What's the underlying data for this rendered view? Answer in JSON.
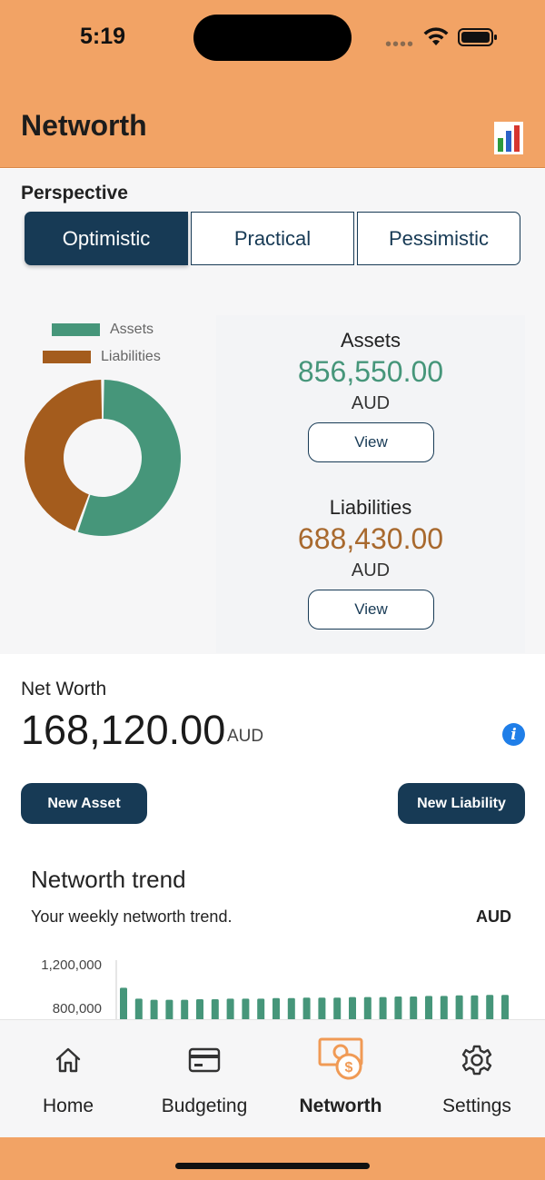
{
  "status": {
    "time": "5:19"
  },
  "header": {
    "title": "Networth"
  },
  "perspective": {
    "label": "Perspective",
    "options": [
      "Optimistic",
      "Practical",
      "Pessimistic"
    ],
    "selected": "Optimistic"
  },
  "legend": [
    {
      "label": "Assets",
      "color": "#46967a"
    },
    {
      "label": "Liabilities",
      "color": "#a45c1d"
    }
  ],
  "assets": {
    "title": "Assets",
    "value": "856,550.00",
    "unit": "AUD",
    "view_label": "View",
    "color": "#46967a"
  },
  "liabilities": {
    "title": "Liabilities",
    "value": "688,430.00",
    "unit": "AUD",
    "view_label": "View",
    "color": "#a8692e"
  },
  "net_worth": {
    "label": "Net Worth",
    "value": "168,120.00",
    "unit": "AUD"
  },
  "actions": {
    "new_asset": "New Asset",
    "new_liability": "New Liability"
  },
  "trend": {
    "title": "Networth trend",
    "subtitle": "Your weekly networth trend.",
    "unit": "AUD",
    "y_ticks": [
      "1,200,000",
      "800,000"
    ]
  },
  "chart_data": [
    {
      "type": "pie",
      "categories": [
        "Assets",
        "Liabilities"
      ],
      "values": [
        856550,
        688430
      ],
      "colors": [
        "#46967a",
        "#a45c1d"
      ],
      "legend": "top-left"
    },
    {
      "type": "bar",
      "title": "Networth trend",
      "ylabel": "AUD",
      "y_ticks": [
        1200000,
        800000
      ],
      "series_color": "#46967a",
      "values": [
        980000,
        880000,
        870000,
        870000,
        870000,
        875000,
        875000,
        880000,
        880000,
        880000,
        885000,
        885000,
        890000,
        890000,
        890000,
        895000,
        895000,
        895000,
        900000,
        900000,
        905000,
        905000,
        910000,
        910000,
        915000,
        915000
      ]
    }
  ],
  "tabs": [
    {
      "label": "Home",
      "icon": "home-icon",
      "active": false
    },
    {
      "label": "Budgeting",
      "icon": "card-icon",
      "active": false
    },
    {
      "label": "Networth",
      "icon": "money-icon",
      "active": true
    },
    {
      "label": "Settings",
      "icon": "gear-icon",
      "active": false
    }
  ]
}
